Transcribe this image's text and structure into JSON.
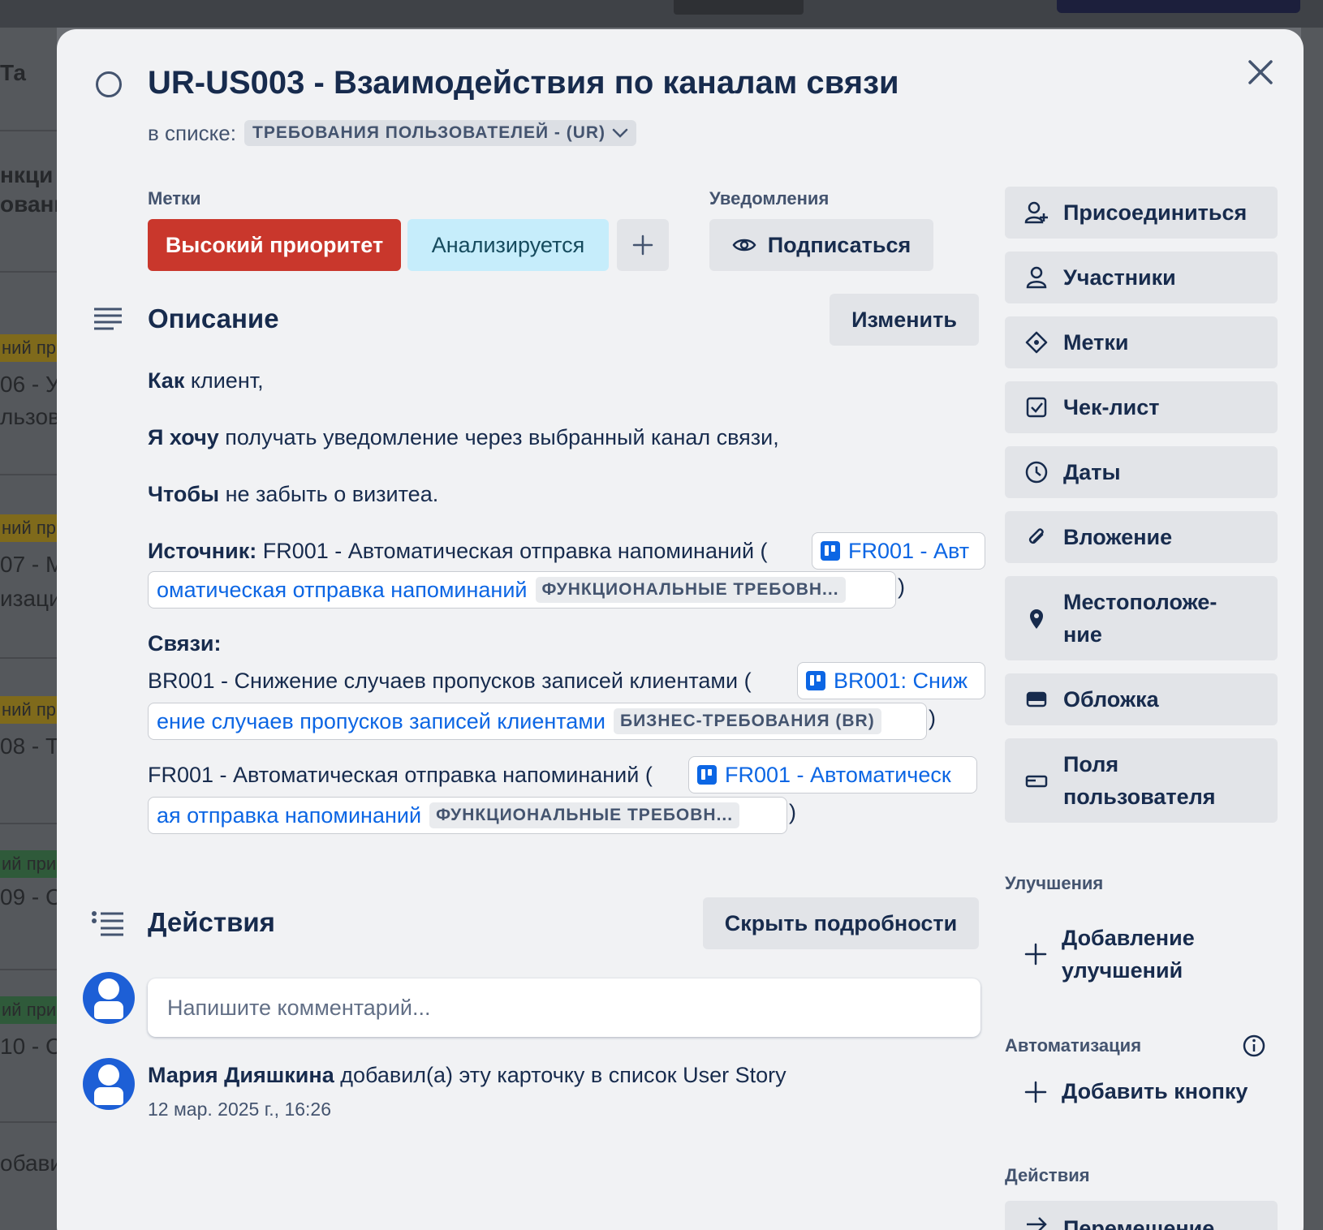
{
  "background": {
    "fragments": [
      "Та",
      "нкци",
      "овани",
      "ний пр",
      "06 - У",
      "льзова",
      "ний пр",
      "07 - М",
      "изаци",
      "ний пр",
      "08 - Т",
      "ий при",
      "09 - С",
      "ий при",
      "10 - С",
      "обави"
    ]
  },
  "card": {
    "title": "UR-US003 - Взаимодействия по каналам связи",
    "in_list_label": "в списке:",
    "list_name": "ТРЕБОВАНИЯ ПОЛЬЗОВАТЕЛЕЙ - (UR)"
  },
  "labels": {
    "heading": "Метки",
    "items": [
      {
        "text": "Высокий приоритет",
        "color": "#c9372c",
        "text_color": "#ffffff"
      },
      {
        "text": "Анализируется",
        "color": "#c6edfb",
        "text_color": "#164b5e"
      }
    ],
    "add_symbol": "+"
  },
  "notifications": {
    "heading": "Уведомления",
    "button": "Подписаться"
  },
  "description": {
    "heading": "Описание",
    "edit_button": "Изменить",
    "as_bold": "Как",
    "as_rest": " клиент,",
    "want_bold": "Я хочу",
    "want_rest": " получать уведомление через выбранный канал связи,",
    "so_bold": "Чтобы",
    "so_rest": " не забыть о визитеа.",
    "source_bold": "Источник:",
    "source_rest": " FR001 - Автоматическая отправка напоминаний (",
    "source_link_line1": "FR001 - Авт",
    "source_link_line2": "оматическая отправка напоминаний",
    "source_link_chip": "ФУНКЦИОНАЛЬНЫЕ ТРЕБОВН...",
    "links_bold": "Связи:",
    "br_text": "BR001 - Снижение случаев пропусков записей клиентами (",
    "br_link_line1": "BR001: Сниж",
    "br_link_line2": "ение случаев пропусков записей клиентами",
    "br_link_chip": "БИЗНЕС-ТРЕБОВАНИЯ (BR)",
    "fr_text": "FR001 - Автоматическая отправка напоминаний (",
    "fr_link_line1": "FR001 - Автоматическ",
    "fr_link_line2": "ая отправка напоминаний",
    "fr_link_chip": "ФУНКЦИОНАЛЬНЫЕ ТРЕБОВН...",
    "close_paren": ")"
  },
  "activity": {
    "heading": "Действия",
    "toggle_button": "Скрыть подробности",
    "comment_placeholder": "Напишите комментарий...",
    "entry_user": "Мария Дияшкина",
    "entry_text": " добавил(а) эту карточку в список User Story",
    "entry_time": "12 мар. 2025 г., 16:26"
  },
  "sidebar": {
    "buttons": [
      {
        "label": "Присоединиться",
        "icon": "user-plus-icon"
      },
      {
        "label": "Участники",
        "icon": "user-icon"
      },
      {
        "label": "Метки",
        "icon": "tag-icon"
      },
      {
        "label": "Чек-лист",
        "icon": "checkbox-icon"
      },
      {
        "label": "Даты",
        "icon": "clock-icon"
      },
      {
        "label": "Вложение",
        "icon": "paperclip-icon"
      },
      {
        "label": "Местоположе-\nние",
        "icon": "location-pin-icon"
      },
      {
        "label": "Обложка",
        "icon": "cover-icon"
      },
      {
        "label": "Поля\nпользователя",
        "icon": "custom-fields-icon"
      }
    ],
    "powerups_heading": "Улучшения",
    "powerups_add": "Добавление\nулучшений",
    "automation_heading": "Автоматизация",
    "automation_add": "Добавить кнопку",
    "actions_heading": "Действия",
    "move_button": "Перемещение"
  }
}
